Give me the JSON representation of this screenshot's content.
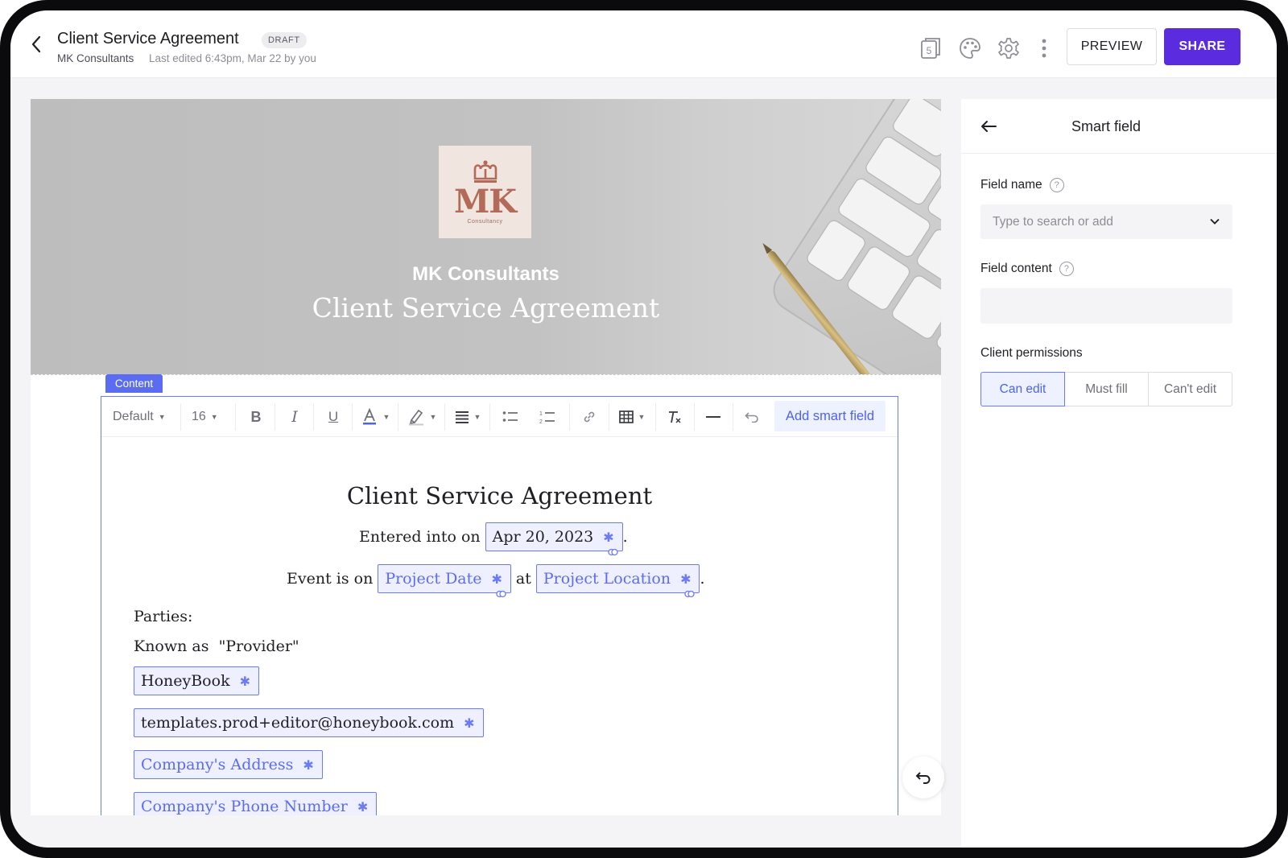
{
  "header": {
    "title": "Client Service Agreement",
    "status_badge": "DRAFT",
    "company": "MK Consultants",
    "last_edited": "Last edited 6:43pm, Mar 22 by you",
    "pages_count": "5",
    "preview_label": "PREVIEW",
    "share_label": "SHARE"
  },
  "banner": {
    "logo_text": "MK",
    "logo_subtext": "Consultancy",
    "company": "MK Consultants",
    "title": "Client Service Agreement"
  },
  "content_tag": "Content",
  "toolbar": {
    "style_select": "Default",
    "font_size": "16",
    "add_smart_field_label": "Add smart field"
  },
  "document": {
    "heading": "Client Service Agreement",
    "entered_into_label": "Entered into on",
    "entered_date": "Apr 20, 2023",
    "period": ".",
    "event_label": "Event is on",
    "project_date": "Project Date",
    "at_label": "at",
    "project_location": "Project Location",
    "period2": ".",
    "parties_label": "Parties:",
    "known_as_label": "Known as  \"Provider\"",
    "provider_name": "HoneyBook",
    "provider_email": "templates.prod+editor@honeybook.com",
    "company_address": "Company's Address",
    "company_phone": "Company's Phone Number"
  },
  "panel": {
    "title": "Smart field",
    "field_name_label": "Field name",
    "field_name_placeholder": "Type to search or add",
    "field_content_label": "Field content",
    "client_permissions_label": "Client permissions",
    "permissions": [
      "Can edit",
      "Must fill",
      "Can't edit"
    ],
    "selected_permission": "Can edit"
  },
  "colors": {
    "accent": "#5b2be0",
    "smart_field_border": "#6b7af5",
    "smart_field_bg": "#eef0ff",
    "content_tag": "#5b6cf2"
  }
}
